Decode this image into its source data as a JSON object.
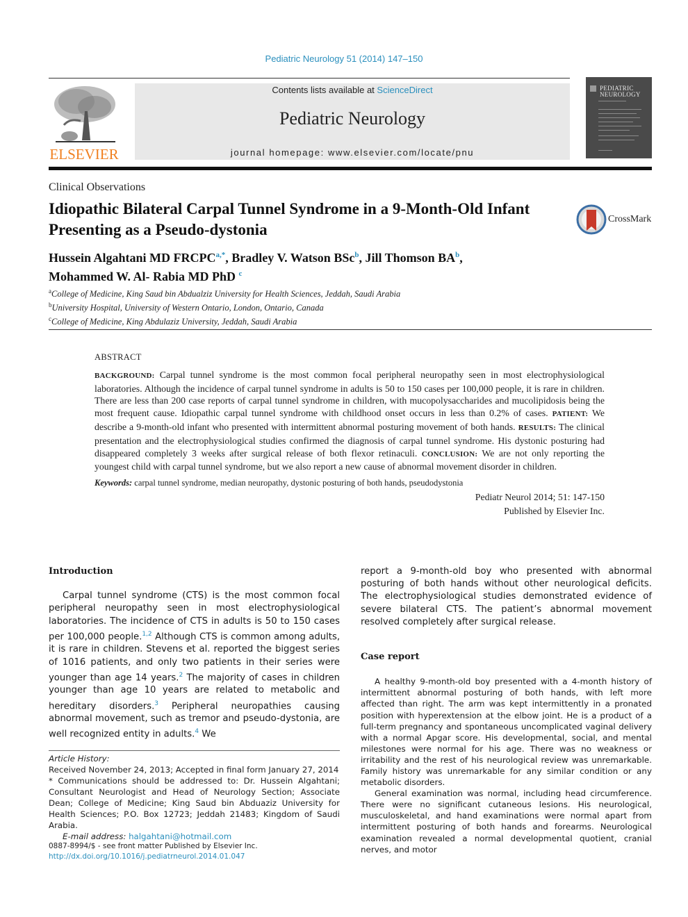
{
  "journal_reference": "Pediatric Neurology 51 (2014) 147–150",
  "header": {
    "publisher_logo_text": "ELSEVIER",
    "contents_prefix": "Contents lists available at ",
    "contents_link": "ScienceDirect",
    "journal_name": "Pediatric Neurology",
    "homepage": "journal homepage: www.elsevier.com/locate/pnu",
    "cover_title_line1": "PEDIATRIC",
    "cover_title_line2": "NEUROLOGY",
    "colors": {
      "link": "#2a8fbd",
      "elsevier_orange": "#f08020",
      "header_bg": "#e8e8e8",
      "cover_bg": "#4a4a4a"
    }
  },
  "article": {
    "section": "Clinical Observations",
    "title": "Idiopathic Bilateral Carpal Tunnel Syndrome in a 9-Month-Old Infant Presenting as a Pseudo-dystonia",
    "crossmark_label": "CrossMark",
    "authors": [
      {
        "name": "Hussein Algahtani MD FRCPC",
        "sup": "a,*",
        "sep": ", "
      },
      {
        "name": "Bradley V. Watson BSc",
        "sup": "b",
        "sep": ", "
      },
      {
        "name": "Jill Thomson BA",
        "sup": "b",
        "sep": ","
      },
      {
        "name": "Mohammed W. Al- Rabia MD PhD",
        "sup": "c",
        "sep": ""
      }
    ],
    "affiliations": [
      {
        "mark": "a",
        "text": "College of Medicine, King Saud bin Abdualziz University for Health Sciences, Jeddah, Saudi Arabia"
      },
      {
        "mark": "b",
        "text": "University Hospital, University of Western Ontario, London, Ontario, Canada"
      },
      {
        "mark": "c",
        "text": "College of Medicine, King Abdulaziz University, Jeddah, Saudi Arabia"
      }
    ]
  },
  "abstract": {
    "heading": "ABSTRACT",
    "sections": [
      {
        "label": "BACKGROUND:",
        "text": " Carpal tunnel syndrome is the most common focal peripheral neuropathy seen in most electrophysiological laboratories. Although the incidence of carpal tunnel syndrome in adults is 50 to 150 cases per 100,000 people, it is rare in children. There are less than 200 case reports of carpal tunnel syndrome in children, with mucopolysaccharides and mucolipidosis being the most frequent cause. Idiopathic carpal tunnel syndrome with childhood onset occurs in less than 0.2% of cases. "
      },
      {
        "label": "PATIENT:",
        "text": " We describe a 9-month-old infant who presented with intermittent abnormal posturing movement of both hands. "
      },
      {
        "label": "RESULTS:",
        "text": " The clinical presentation and the electrophysiological studies confirmed the diagnosis of carpal tunnel syndrome. His dystonic posturing had disappeared completely 3 weeks after surgical release of both flexor retinaculi. "
      },
      {
        "label": "CONCLUSION:",
        "text": " We are not only reporting the youngest child with carpal tunnel syndrome, but we also report a new cause of abnormal movement disorder in children."
      }
    ],
    "keywords_label": "Keywords:",
    "keywords": " carpal tunnel syndrome, median neuropathy, dystonic posturing of both hands, pseudodystonia",
    "citation": "Pediatr Neurol 2014; 51: 147-150",
    "publisher_line": "Published by Elsevier Inc."
  },
  "introduction": {
    "heading": "Introduction",
    "segments": [
      {
        "t": "Carpal tunnel syndrome (CTS) is the most common focal peripheral neuropathy seen in most electrophysiological laboratories. The incidence of CTS in adults is 50 to 150 cases per 100,000 people."
      },
      {
        "ref": "1,2"
      },
      {
        "t": " Although CTS is common among adults, it is rare in children. Stevens et al. reported the biggest series of 1016 patients, and only two patients in their series were younger than age 14 years."
      },
      {
        "ref": "2"
      },
      {
        "t": " The majority of cases in children younger than age 10 years are related to metabolic and hereditary disorders."
      },
      {
        "ref": "3"
      },
      {
        "t": " Peripheral neuropathies causing abnormal movement, such as tremor and pseudo-dystonia, are well recognized entity in adults."
      },
      {
        "ref": "4"
      },
      {
        "t": " We"
      }
    ],
    "continuation": "report a 9-month-old boy who presented with abnormal posturing of both hands without other neurological deficits. The electrophysiological studies demonstrated evidence of severe bilateral CTS. The patient’s abnormal movement resolved completely after surgical release."
  },
  "case_report": {
    "heading": "Case report",
    "paragraphs": [
      "A healthy 9-month-old boy presented with a 4-month history of intermittent abnormal posturing of both hands, with left more affected than right. The arm was kept intermittently in a pronated position with hyperextension at the elbow joint. He is a product of a full-term pregnancy and spontaneous uncomplicated vaginal delivery with a normal Apgar score. His developmental, social, and mental milestones were normal for his age. There was no weakness or irritability and the rest of his neurological review was unremarkable. Family history was unremarkable for any similar condition or any metabolic disorders.",
      "General examination was normal, including head circumference. There were no significant cutaneous lesions. His neurological, musculoskeletal, and hand examinations were normal apart from intermittent posturing of both hands and forearms. Neurological examination revealed a normal developmental quotient, cranial nerves, and motor"
    ]
  },
  "footnotes": {
    "history_label": "Article History:",
    "history": "Received November 24, 2013; Accepted in final form January 27, 2014",
    "correspondence": " * Communications should be addressed to: Dr. Hussein Algahtani; Consultant Neurologist and Head of Neurology Section; Associate Dean; College of Medicine; King Saud bin Abduaziz University for Health Sciences; P.O. Box 12723; Jeddah 21483; Kingdom of Saudi Arabia.",
    "email_label": "E-mail address: ",
    "email": "halgahtani@hotmail.com",
    "issn_line": "0887-8994/$ - see front matter Published by Elsevier Inc.",
    "doi": "http://dx.doi.org/10.1016/j.pediatrneurol.2014.01.047"
  }
}
